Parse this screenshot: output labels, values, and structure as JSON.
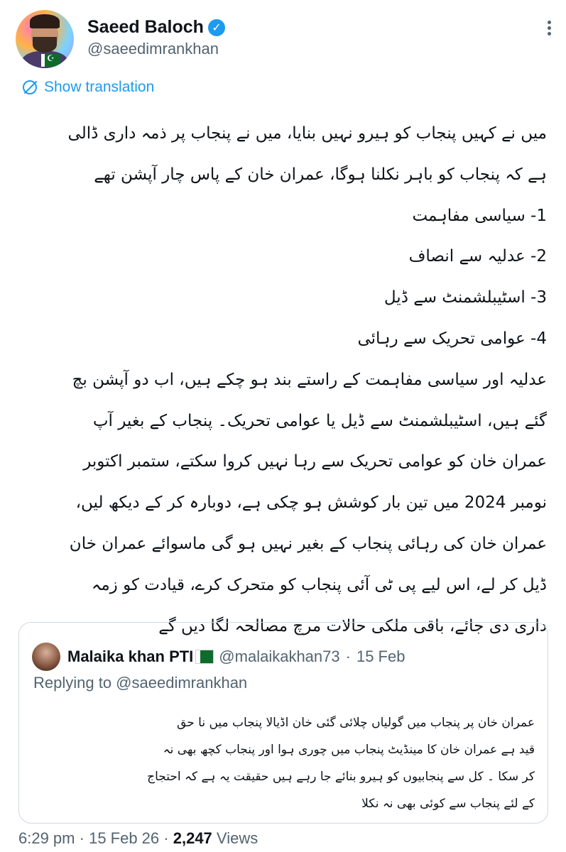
{
  "author": {
    "name": "Saeed Baloch",
    "handle": "@saeedimrankhan",
    "verified": true,
    "verified_icon": "verified-badge-icon",
    "accent_color": "#1d9bf0"
  },
  "translate": {
    "label": "Show translation",
    "icon": "translate-off-icon"
  },
  "tweet": {
    "lines": [
      "میں نے کہیں پنجاب کو ہیرو نہیں بنایا، میں نے پنجاب پر ذمہ داری ڈالی",
      "ہے کہ پنجاب کو باہر نکلنا ہوگا، عمران خان کے پاس چار آپشن تھے",
      "1- سیاسی مفاہمت",
      "2- عدلیہ سے انصاف",
      "3- اسٹیبلشمنٹ سے ڈیل",
      "4- عوامی تحریک سے رہائی",
      "عدلیہ اور سیاسی مفاہمت کے راستے بند ہو چکے ہیں، اب دو آپشن بچ",
      "گئے ہیں، اسٹیبلشمنٹ سے ڈیل یا عوامی تحریک۔ پنجاب کے بغیر آپ",
      "عمران خان کو عوامی تحریک سے رہا نہیں کروا سکتے، ستمبر اکتوبر",
      "نومبر 2024 میں تین بار کوشش ہو چکی ہے، دوبارہ کر کے دیکھ لیں،",
      "عمران خان کی رہائی پنجاب کے بغیر نہیں ہو گی ماسوائے عمران خان",
      "ڈیل کر لے، اس لیے پی ٹی آئی پنجاب کو متحرک کرے، قیادت کو زمہ",
      "داری دی جائے، باقی ملکی حالات مرچ مصالحہ لگا دیں گے"
    ]
  },
  "quote": {
    "name": "Malaika khan PTI",
    "flag_icon": "pakistan-flag-icon",
    "handle": "@malaikakhan73",
    "separator": "·",
    "date": "15 Feb",
    "replying_to": "Replying to @saeedimrankhan",
    "lines": [
      "عمران خان پر پنجاب میں گولیاں چلائی گئی خان اڈیالا پنجاب میں نا حق",
      "قید ہے عمران خان کا مینڈیٹ پنجاب میں چوری ہوا اور پنجاب کچھ بھی نہ",
      "کر سکا ۔ کل سے پنجابیوں کو ہیرو بنائے جا رہے ہیں حقیقت یہ ہے کہ احتجاج",
      "کے لئے پنجاب سے کوئی بھی نہ نکلا"
    ]
  },
  "meta": {
    "time": "6:29 pm",
    "sep1": "·",
    "date": "15 Feb 26",
    "sep2": "·",
    "views_count": "2,247",
    "views_label": "Views"
  },
  "icons": {
    "more": "more-options-icon"
  }
}
